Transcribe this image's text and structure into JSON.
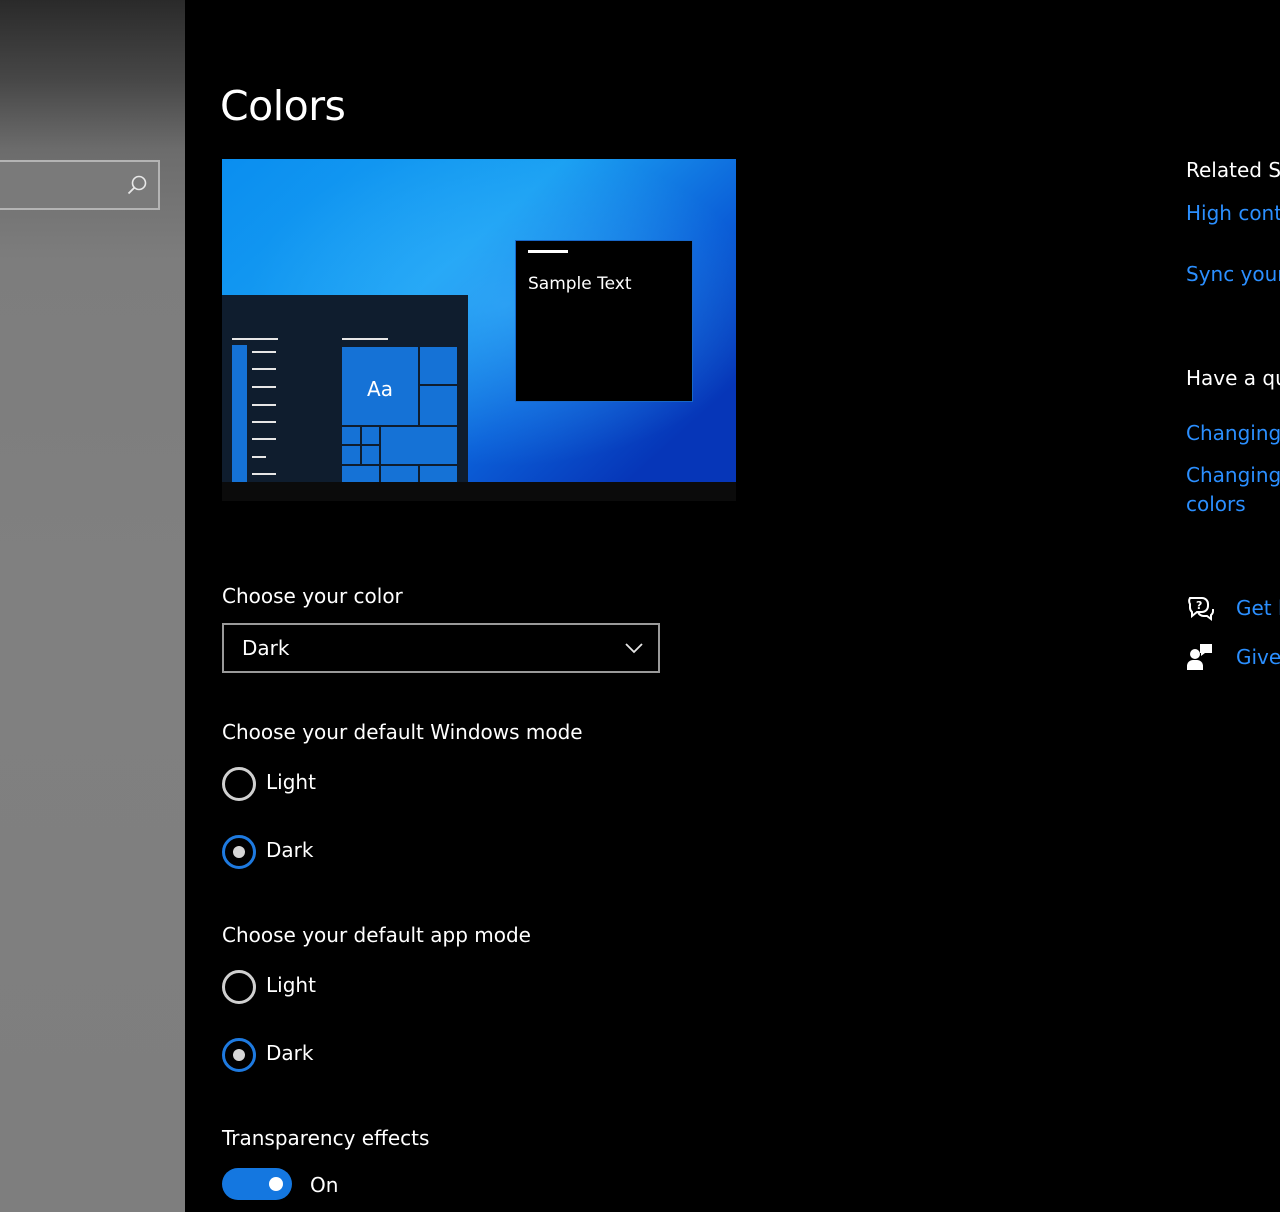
{
  "window": {
    "title": "Colors"
  },
  "nav": {
    "search": {
      "value": "",
      "placeholder": ""
    }
  },
  "preview": {
    "sample_text": "Sample Text",
    "tile_text": "Aa"
  },
  "choose_color": {
    "label": "Choose your color",
    "selected": "Dark"
  },
  "windows_mode": {
    "label": "Choose your default Windows mode",
    "options": [
      {
        "label": "Light",
        "checked": false
      },
      {
        "label": "Dark",
        "checked": true
      }
    ]
  },
  "app_mode": {
    "label": "Choose your default app mode",
    "options": [
      {
        "label": "Light",
        "checked": false
      },
      {
        "label": "Dark",
        "checked": true
      }
    ]
  },
  "transparency": {
    "label": "Transparency effects",
    "state": "On"
  },
  "related": {
    "heading": "Related Se",
    "links": [
      "High cont",
      "Sync your"
    ]
  },
  "question": {
    "heading": "Have a qu",
    "links": [
      "Changing",
      "Changing colors"
    ]
  },
  "help": {
    "get_help": "Get h",
    "give_feedback": "Give"
  },
  "colors": {
    "accent": "#0078d7",
    "link": "#2b8fff",
    "background": "#000000"
  }
}
